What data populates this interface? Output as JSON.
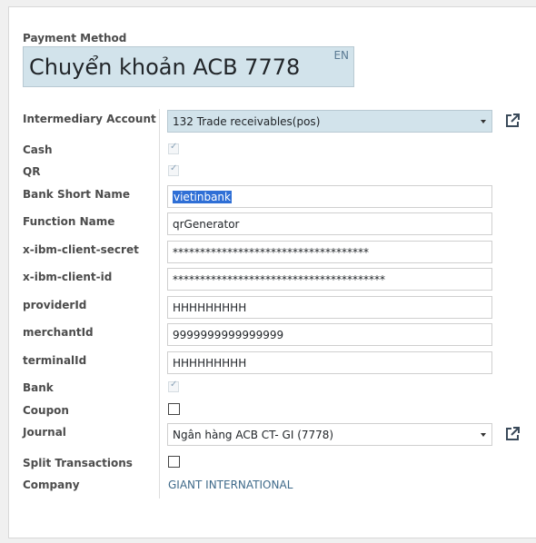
{
  "payment_method": {
    "label": "Payment Method",
    "value": "Chuyển khoản ACB 7778",
    "lang": "EN"
  },
  "fields": {
    "intermediary_account": {
      "label": "Intermediary Account",
      "value": "132 Trade receivables(pos)"
    },
    "cash": {
      "label": "Cash",
      "checked": true
    },
    "qr": {
      "label": "QR",
      "checked": true
    },
    "bank_short_name": {
      "label": "Bank Short Name",
      "value": "vietinbank"
    },
    "function_name": {
      "label": "Function Name",
      "value": "qrGenerator"
    },
    "client_secret": {
      "label": "x-ibm-client-secret",
      "value": "************************************"
    },
    "client_id": {
      "label": "x-ibm-client-id",
      "value": "***************************************"
    },
    "provider_id": {
      "label": "providerId",
      "value": "HHHHHHHHH"
    },
    "merchant_id": {
      "label": "merchantId",
      "value": "9999999999999999"
    },
    "terminal_id": {
      "label": "terminalId",
      "value": "HHHHHHHHH"
    },
    "bank": {
      "label": "Bank",
      "checked": true
    },
    "coupon": {
      "label": "Coupon",
      "checked": false
    },
    "journal": {
      "label": "Journal",
      "value": "Ngân hàng ACB CT- GI (7778)"
    },
    "split_transactions": {
      "label": "Split Transactions",
      "checked": false
    },
    "company": {
      "label": "Company",
      "value": "GIANT INTERNATIONAL"
    }
  },
  "icons": {
    "external_link": "external-link-icon",
    "dropdown": "caret-down-icon"
  },
  "colors": {
    "accent_field_bg": "#d2e3eb",
    "link": "#3f6a8a",
    "selection": "#2f6fd6"
  }
}
